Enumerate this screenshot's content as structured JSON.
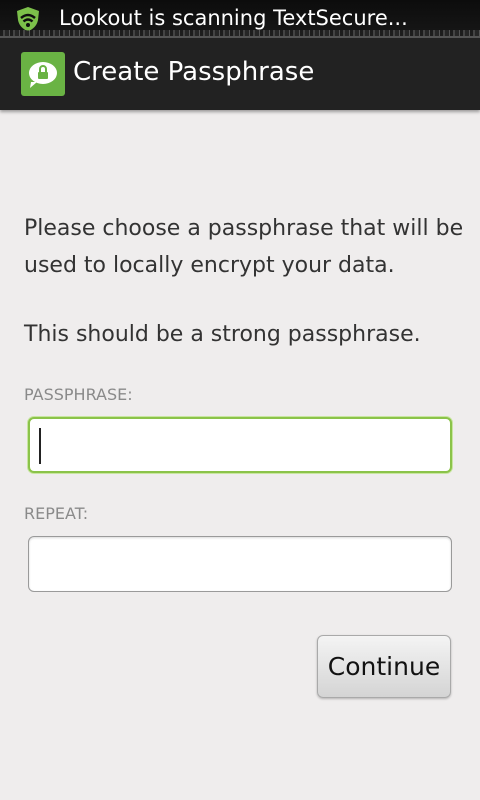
{
  "status_bar": {
    "icon": "lookout-shield-icon",
    "notification": "Lookout is scanning TextSecure..."
  },
  "action_bar": {
    "icon": "textsecure-lock-bubble-icon",
    "title": "Create Passphrase",
    "accent_color": "#6ab344"
  },
  "content": {
    "intro": "Please choose a passphrase that will be used to locally encrypt your data.",
    "strength_note": "This should be a strong passphrase.",
    "passphrase_label": "PASSPHRASE:",
    "passphrase_value": "",
    "repeat_label": "REPEAT:",
    "repeat_value": "",
    "focus_color": "#8bc34a"
  },
  "actions": {
    "continue_label": "Continue"
  }
}
